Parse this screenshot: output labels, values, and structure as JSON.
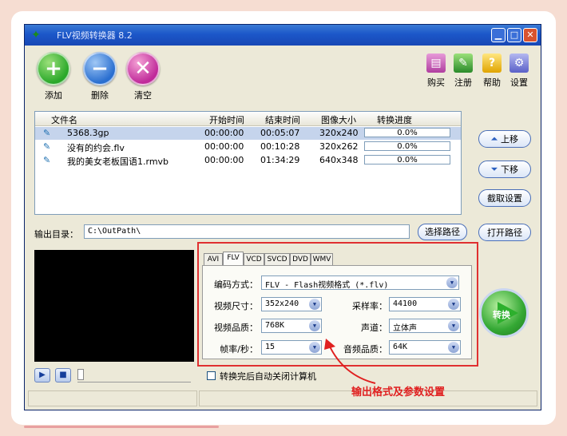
{
  "window": {
    "title": "FLV视频转换器 8.2"
  },
  "toolbar": {
    "add": "添加",
    "delete": "删除",
    "clear": "清空",
    "buy": "购买",
    "register": "注册",
    "help": "帮助",
    "settings": "设置"
  },
  "file_list": {
    "columns": [
      "文件名",
      "开始时间",
      "结束时间",
      "图像大小",
      "转换进度"
    ],
    "rows": [
      {
        "name": "5368.3gp",
        "start": "00:00:00",
        "end": "00:05:07",
        "size": "320x240",
        "progress": "0.0%"
      },
      {
        "name": "没有的约会.flv",
        "start": "00:00:00",
        "end": "00:10:28",
        "size": "320x262",
        "progress": "0.0%"
      },
      {
        "name": "我的美女老板国语1.rmvb",
        "start": "00:00:00",
        "end": "01:34:29",
        "size": "640x348",
        "progress": "0.0%"
      }
    ]
  },
  "side_buttons": {
    "up": "上移",
    "down": "下移",
    "crop": "截取设置",
    "open_path": "打开路径"
  },
  "output": {
    "label": "输出目录：",
    "path": "C:\\OutPath\\",
    "choose": "选择路径"
  },
  "format_tabs": [
    "AVI",
    "FLV",
    "VCD",
    "SVCD",
    "DVD",
    "WMV"
  ],
  "format_settings": {
    "encoding_label": "编码方式：",
    "encoding_value": "FLV - Flash视频格式 (*.flv)",
    "video_size_label": "视频尺寸：",
    "video_size_value": "352x240",
    "video_quality_label": "视频品质：",
    "video_quality_value": "768K",
    "fps_label": "帧率/秒：",
    "fps_value": "15",
    "sample_rate_label": "采样率：",
    "sample_rate_value": "44100",
    "channel_label": "声道：",
    "channel_value": "立体声",
    "audio_quality_label": "音频品质：",
    "audio_quality_value": "64K"
  },
  "convert_button": "转换",
  "shutdown_checkbox": "转换完后自动关闭计算机",
  "annotation": "输出格式及参数设置",
  "colors": {
    "title_bar": "#1c57c9",
    "highlight_red": "#e02020",
    "selected_row": "#c5d4ec"
  }
}
